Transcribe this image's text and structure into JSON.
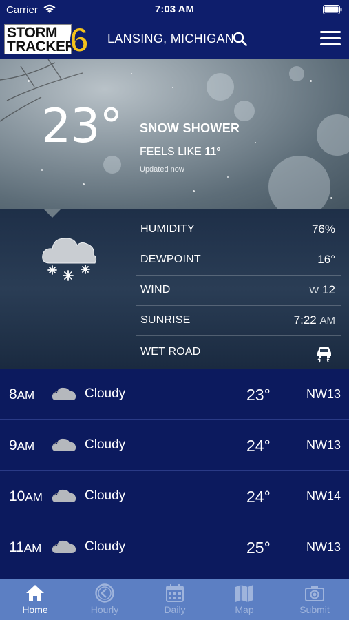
{
  "status": {
    "carrier": "Carrier",
    "time": "7:03 AM"
  },
  "header": {
    "logo_top": "STORM",
    "logo_bottom": "TRACKER",
    "logo_number": "6",
    "location": "LANSING, MICHIGAN"
  },
  "current": {
    "temperature": "23°",
    "condition": "SNOW SHOWER",
    "feels_label": "FEELS LIKE",
    "feels_value": "11°",
    "updated": "Updated now"
  },
  "details": [
    {
      "label": "HUMIDITY",
      "value": "76%"
    },
    {
      "label": "DEWPOINT",
      "value": "16°"
    },
    {
      "label": "WIND",
      "dir": "W",
      "value": "12"
    },
    {
      "label": "SUNRISE",
      "value": "7:22",
      "suffix": "AM"
    },
    {
      "label": "WET ROAD",
      "icon": "slippery-road-icon"
    }
  ],
  "hourly": [
    {
      "hour": "8",
      "ampm": "AM",
      "condition": "Cloudy",
      "temp": "23°",
      "wind": "NW13",
      "icon": "cloudy-icon"
    },
    {
      "hour": "9",
      "ampm": "AM",
      "condition": "Cloudy",
      "temp": "24°",
      "wind": "NW13",
      "icon": "cloudy-icon"
    },
    {
      "hour": "10",
      "ampm": "AM",
      "condition": "Cloudy",
      "temp": "24°",
      "wind": "NW14",
      "icon": "cloudy-icon"
    },
    {
      "hour": "11",
      "ampm": "AM",
      "condition": "Cloudy",
      "temp": "25°",
      "wind": "NW13",
      "icon": "cloudy-icon"
    }
  ],
  "tabs": [
    {
      "label": "Home",
      "icon": "home-icon",
      "active": true
    },
    {
      "label": "Hourly",
      "icon": "clock-icon",
      "active": false
    },
    {
      "label": "Daily",
      "icon": "calendar-icon",
      "active": false
    },
    {
      "label": "Map",
      "icon": "map-icon",
      "active": false
    },
    {
      "label": "Submit",
      "icon": "camera-icon",
      "active": false
    }
  ],
  "colors": {
    "header_bg": "#0e1e6c",
    "hourly_bg": "#0c1a5e",
    "tabbar_bg": "#5c7fc3",
    "tab_inactive": "#9fb4dc"
  }
}
